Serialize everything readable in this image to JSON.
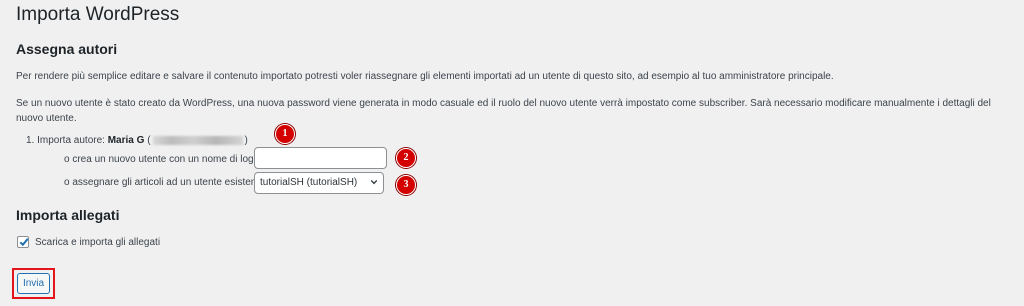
{
  "page": {
    "title": "Importa WordPress"
  },
  "authors": {
    "heading": "Assegna autori",
    "intro": "Per rendere più semplice editare e salvare il contenuto importato potresti voler riassegnare gli elementi importati ad un utente di questo sito, ad esempio al tuo amministratore principale.",
    "note": "Se un nuovo utente è stato creato da WordPress, una nuova password viene generata in modo casuale ed il ruolo del nuovo utente verrà impostato come subscriber. Sarà necessario modificare manualmente i dettagli del nuovo utente.",
    "item_prefix": "1. Importa autore:",
    "author_name": "Maria G",
    "open_paren": "(",
    "close_paren": ")",
    "new_user_label": "o crea un nuovo utente con un nome di login:",
    "new_user_value": "",
    "existing_user_label": "o assegnare gli articoli ad un utente esistente:",
    "existing_user_selected": "tutorialSH (tutorialSH)"
  },
  "attachments": {
    "heading": "Importa allegati",
    "checkbox_label": "Scarica e importa gli allegati",
    "checked": true
  },
  "submit": {
    "label": "Invia"
  },
  "badges": [
    "1",
    "2",
    "3"
  ],
  "colors": {
    "badge": "#d40000",
    "highlight": "#e3151a",
    "primary": "#2271b1",
    "background": "#f0f0f1"
  }
}
